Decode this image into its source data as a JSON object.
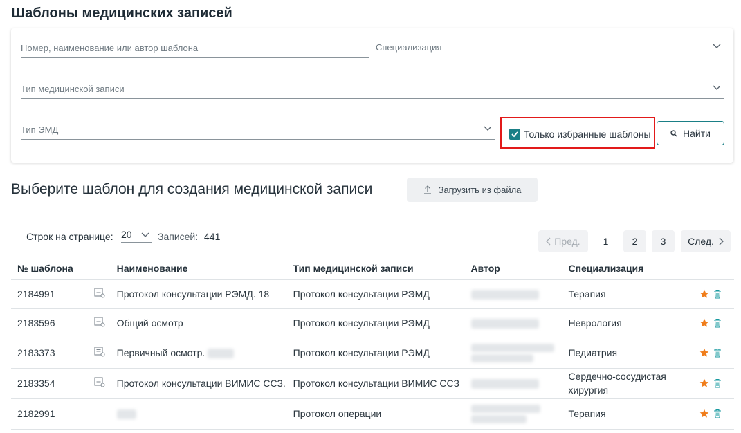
{
  "page": {
    "title": "Шаблоны медицинских записей"
  },
  "filters": {
    "search_placeholder": "Номер, наименование или автор шаблона",
    "specialization_placeholder": "Специализация",
    "record_type_placeholder": "Тип медицинской записи",
    "emd_type_placeholder": "Тип ЭМД",
    "favorites_only_label": "Только избранные шаблоны",
    "favorites_only_checked": true,
    "find_button": "Найти"
  },
  "section": {
    "title": "Выберите шаблон для создания медицинской записи",
    "upload_button": "Загрузить из файла"
  },
  "pagination": {
    "rows_per_page_label": "Строк на странице:",
    "rows_per_page_value": "20",
    "records_label": "Записей:",
    "records_count": "441",
    "prev_label": "Пред.",
    "next_label": "След.",
    "pages": [
      "1",
      "2",
      "3"
    ],
    "current_page": "1"
  },
  "table": {
    "headers": [
      "№ шаблона",
      "Наименование",
      "Тип медицинской записи",
      "Автор",
      "Специализация"
    ],
    "rows": [
      {
        "number": "2184991",
        "name": "Протокол консультации РЭМД. 18",
        "type": "Протокол консультации РЭМД",
        "specialization": "Терапия"
      },
      {
        "number": "2183596",
        "name": "Общий осмотр",
        "type": "Протокол консультации РЭМД",
        "specialization": "Неврология"
      },
      {
        "number": "2183373",
        "name": "Первичный осмотр.",
        "type": "Протокол консультации РЭМД",
        "specialization": "Педиатрия"
      },
      {
        "number": "2183354",
        "name": "Протокол консультации ВИМИС ССЗ.",
        "type": "Протокол консультации ВИМИС ССЗ",
        "specialization": "Сердечно-сосудистая хирургия"
      },
      {
        "number": "2182991",
        "name": "",
        "type": "Протокол операции",
        "specialization": "Терапия"
      }
    ]
  },
  "colors": {
    "accent": "#1a7f86",
    "highlight_border": "#e21a1a",
    "star": "#f07d1a"
  },
  "icons": {
    "search": "search-icon",
    "upload": "upload-icon",
    "template": "document-icon",
    "favorite": "star-icon",
    "delete": "trash-icon"
  }
}
